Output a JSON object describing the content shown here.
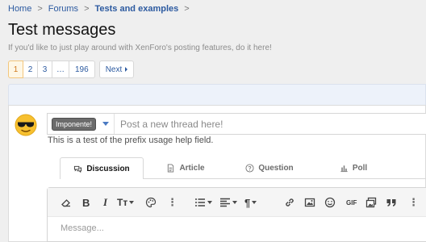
{
  "breadcrumb": {
    "items": [
      {
        "label": "Home"
      },
      {
        "label": "Forums"
      },
      {
        "label": "Tests and examples"
      }
    ],
    "separator": ">"
  },
  "page": {
    "title": "Test messages",
    "description": "If you'd like to just play around with XenForo's posting features, do it here!"
  },
  "pager": {
    "pages": [
      "1",
      "2",
      "3",
      "…",
      "196"
    ],
    "current": "1",
    "next_label": "Next"
  },
  "composer": {
    "prefix_label": "Imponente!",
    "title_placeholder": "Post a new thread here!",
    "help_text": "This is a test of the prefix usage help field.",
    "tabs": [
      {
        "label": "Discussion",
        "icon": "discussion-icon",
        "active": true
      },
      {
        "label": "Article",
        "icon": "article-icon",
        "active": false
      },
      {
        "label": "Question",
        "icon": "question-icon",
        "active": false
      },
      {
        "label": "Poll",
        "icon": "poll-icon",
        "active": false
      }
    ],
    "toolbar": {
      "buttons": [
        "eraser-icon",
        "bold-icon",
        "italic-icon",
        "font-size-icon",
        "palette-icon",
        "more-vertical-icon",
        "list-icon",
        "align-icon",
        "paragraph-icon",
        "link-icon",
        "image-icon",
        "smilie-icon",
        "gif-icon",
        "media-icon",
        "quote-icon",
        "more-vertical-icon"
      ],
      "bold_glyph": "B",
      "italic_glyph": "I",
      "font_size_glyph": "Tт",
      "paragraph_glyph": "¶",
      "gif_glyph": "GIF",
      "more_glyph": "⋮"
    },
    "message_placeholder": "Message..."
  },
  "colors": {
    "link": "#2c5aa0",
    "page_background": "#efefef",
    "active_page_bg": "#fef7e6",
    "active_page_text": "#d07a1f",
    "prefix_bg": "#6b6b6b"
  }
}
